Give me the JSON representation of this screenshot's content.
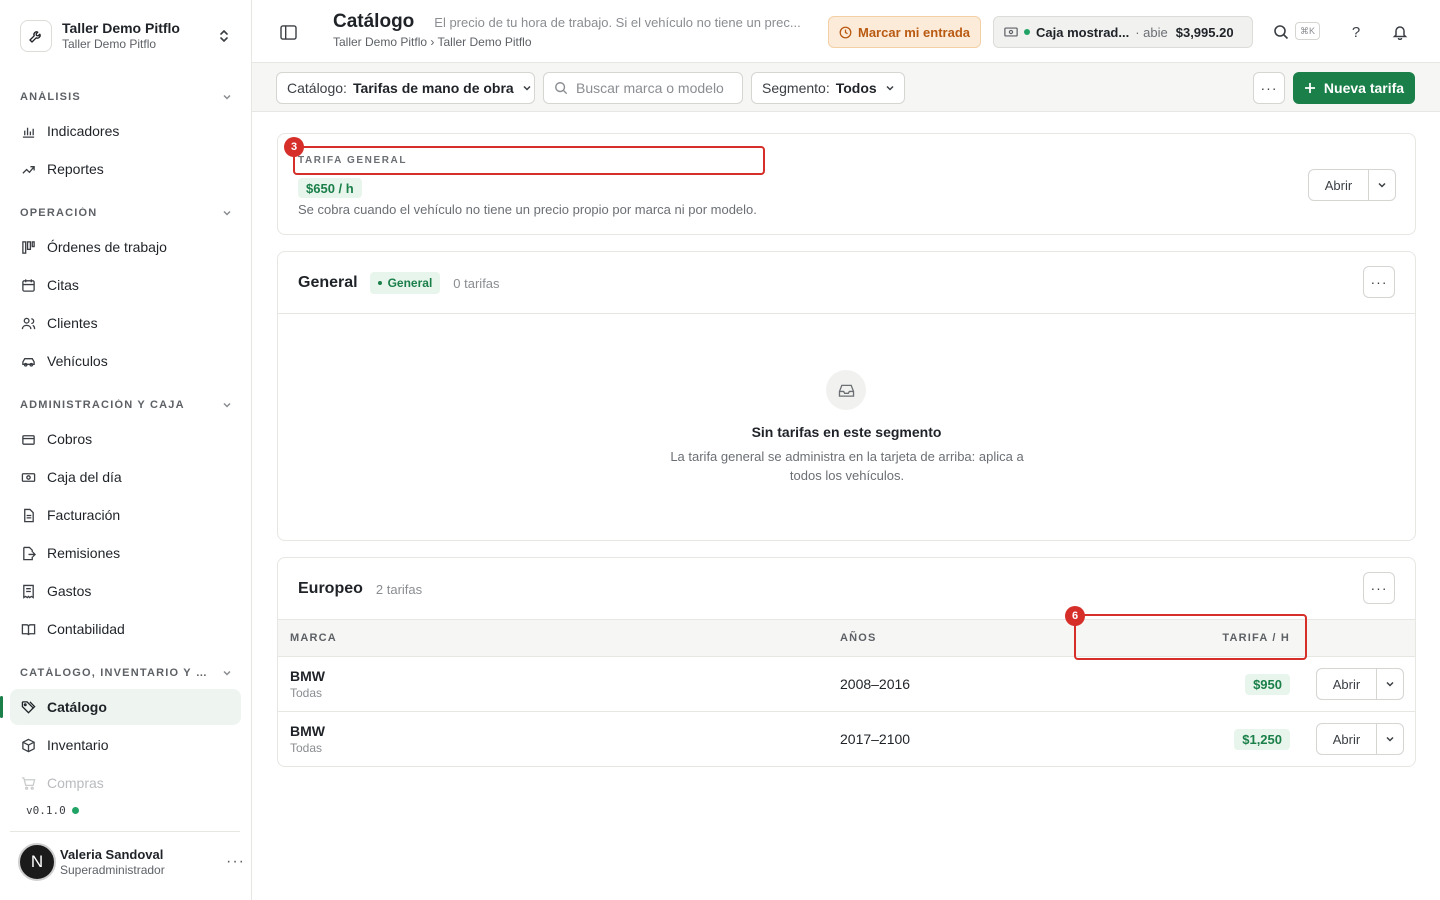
{
  "org": {
    "name": "Taller Demo Pitflo",
    "sub": "Taller Demo Pitflo"
  },
  "sidebar": {
    "sections": [
      {
        "label": "ANÁLISIS",
        "items": [
          "Indicadores",
          "Reportes"
        ]
      },
      {
        "label": "OPERACIÓN",
        "items": [
          "Órdenes de trabajo",
          "Citas",
          "Clientes",
          "Vehículos"
        ]
      },
      {
        "label": "ADMINISTRACIÓN Y CAJA",
        "items": [
          "Cobros",
          "Caja del día",
          "Facturación",
          "Remisiones",
          "Gastos",
          "Contabilidad"
        ]
      },
      {
        "label": "CATÁLOGO, INVENTARIO Y CO...",
        "items": [
          "Catálogo",
          "Inventario",
          "Compras"
        ]
      }
    ],
    "version": "v0.1.0"
  },
  "user": {
    "initial": "N",
    "name": "Valeria Sandoval",
    "role": "Superadministrador"
  },
  "header": {
    "title": "Catálogo",
    "description": "El precio de tu hora de trabajo. Si el vehículo no tiene un prec...",
    "breadcrumb": "Taller Demo Pitflo › Taller Demo Pitflo",
    "entrada_label": "Marcar mi entrada",
    "caja": {
      "name": "Caja mostrad...",
      "status": "abie",
      "amount": "$3,995.20"
    },
    "shortcut": "⌘K",
    "help": "?"
  },
  "toolbar": {
    "catalog_label": "Catálogo:",
    "catalog_value": "Tarifas de mano de obra",
    "search_placeholder": "Buscar marca o modelo",
    "segment_label": "Segmento:",
    "segment_value": "Todos",
    "more": "···",
    "new_label": "Nueva tarifa"
  },
  "general_rate": {
    "eyebrow": "TARIFA GENERAL",
    "rate": "$650 / h",
    "description": "Se cobra cuando el vehículo no tiene un precio propio por marca ni por modelo.",
    "open_label": "Abrir"
  },
  "segments": {
    "general": {
      "title": "General",
      "badge": "General",
      "count": "0 tarifas",
      "empty_title": "Sin tarifas en este segmento",
      "empty_desc": "La tarifa general se administra en la tarjeta de arriba: aplica a todos los vehículos."
    },
    "europeo": {
      "title": "Europeo",
      "count": "2 tarifas",
      "columns": {
        "brand": "MARCA",
        "years": "AÑOS",
        "rate": "TARIFA / H"
      },
      "rows": [
        {
          "brand": "BMW",
          "model": "Todas",
          "years": "2008–2016",
          "rate": "$950",
          "open": "Abrir"
        },
        {
          "brand": "BMW",
          "model": "Todas",
          "years": "2017–2100",
          "rate": "$1,250",
          "open": "Abrir"
        }
      ]
    }
  },
  "annotations": {
    "a3": "3",
    "a6": "6"
  },
  "colors": {
    "accent": "#1a7f49",
    "warning_bg": "#fcebd9",
    "warning_text": "#b95a12",
    "annotation": "#d62f2a"
  }
}
